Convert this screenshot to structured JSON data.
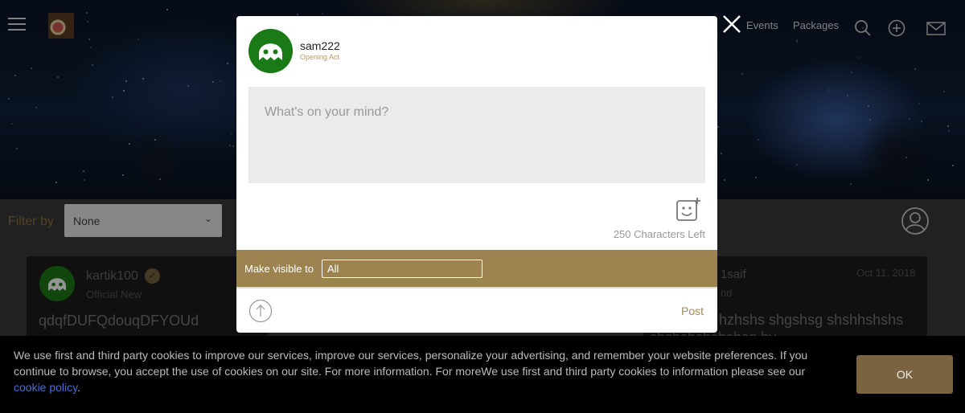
{
  "nav": {
    "events_label": "Events",
    "packages_label": "Packages"
  },
  "filter": {
    "label": "Filter by",
    "selected": "None"
  },
  "feed": {
    "left_post": {
      "username": "kartik100",
      "role": "Official New",
      "text": "qdqfDUFQdouqDFYOUd"
    },
    "right_post": {
      "username_partial": "1saif",
      "role_partial": "nd",
      "date": "Oct 11, 2018",
      "text": "v hzhshs shgshsg shshhshshs",
      "text_line2": "sbsbsbsbsbsbsg by"
    }
  },
  "modal": {
    "username": "sam222",
    "role": "Opening Act",
    "textarea_placeholder": "What's on your mind?",
    "characters_left": "250 Characters Left",
    "visibility_label": "Make visible to",
    "visibility_value": "All",
    "post_label": "Post"
  },
  "cookie": {
    "text": "We use first and third party cookies to improve our services, improve our services, personalize your advertising, and remember your website preferences. If you continue to browse, you accept the use of cookies on our site. For more information. For moreWe use first and third party cookies to information please see our ",
    "link_label": "cookie policy",
    "trailing": ".",
    "ok_label": "OK"
  },
  "colors": {
    "accent_gold": "#9d8350",
    "avatar_green": "#1a7a16",
    "link_blue": "#4a6fd0"
  },
  "icons": [
    "menu-icon",
    "search-icon",
    "add-circle-icon",
    "mail-icon",
    "user-profile-icon",
    "close-icon",
    "add-emoji-icon",
    "upload-arrow-icon",
    "verified-badge-icon",
    "chevron-down-icon"
  ]
}
